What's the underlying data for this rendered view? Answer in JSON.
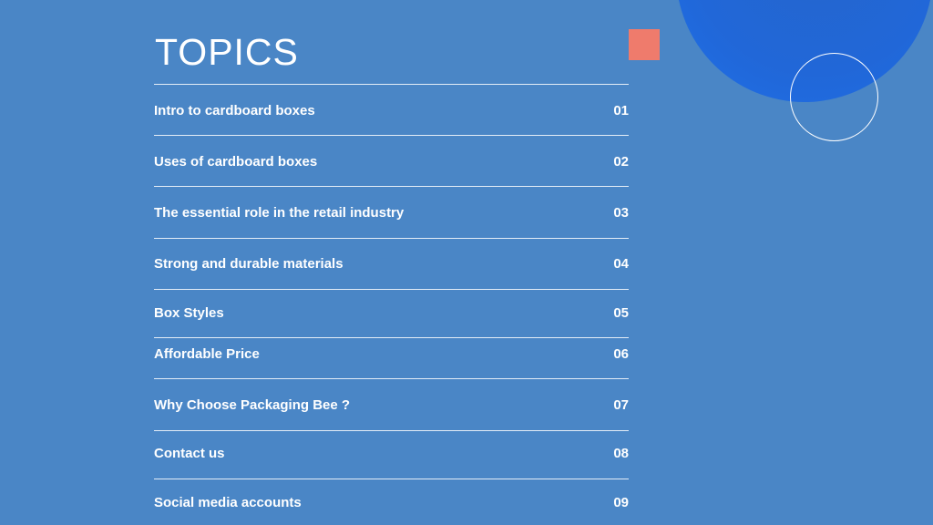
{
  "title": "TOPICS",
  "colors": {
    "background": "#4a86c6",
    "accent_square": "#ef7b6c",
    "circle": "#2167d8",
    "text": "#ffffff"
  },
  "topics": [
    {
      "label": "Intro to cardboard boxes",
      "number": "01"
    },
    {
      "label": "Uses of cardboard boxes",
      "number": "02"
    },
    {
      "label": "The essential role in the retail industry",
      "number": "03"
    },
    {
      "label": "Strong and durable materials",
      "number": "04"
    },
    {
      "label": "Box Styles",
      "number": "05"
    },
    {
      "label": "Affordable Price",
      "number": "06"
    },
    {
      "label": "Why Choose Packaging Bee ?",
      "number": "07"
    },
    {
      "label": "Contact us",
      "number": "08"
    },
    {
      "label": "Social media accounts",
      "number": "09"
    }
  ]
}
